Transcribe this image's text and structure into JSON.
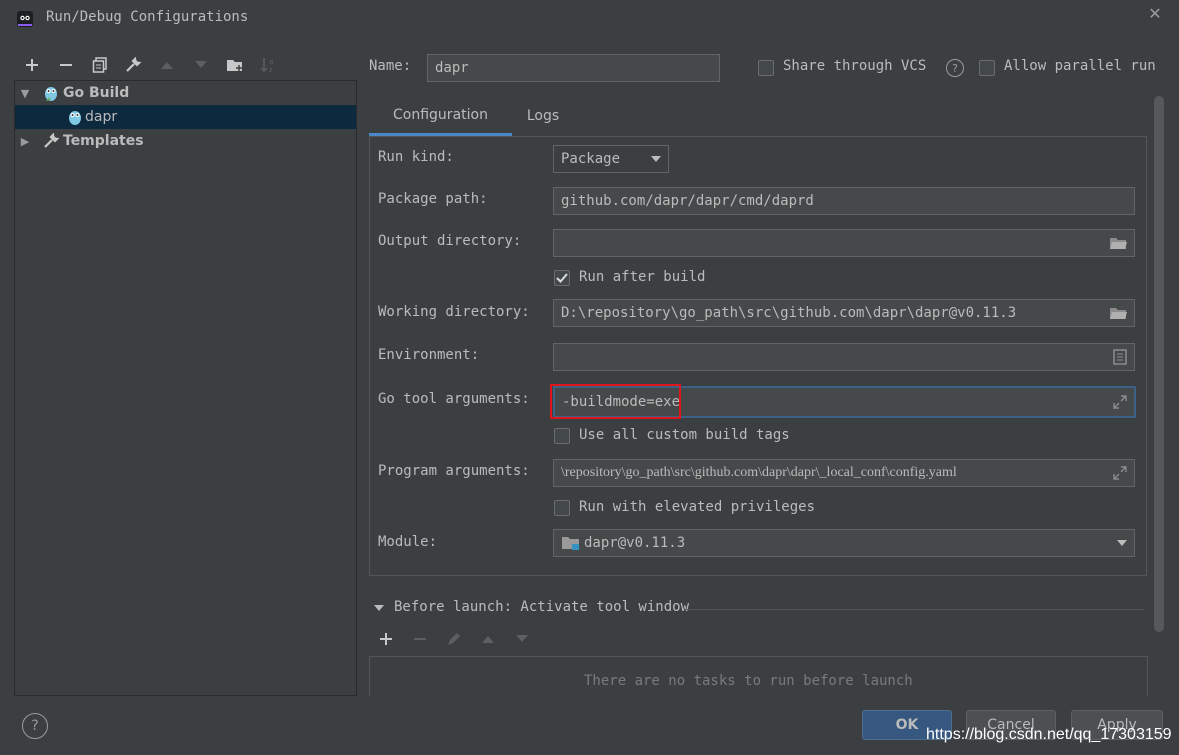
{
  "window": {
    "title": "Run/Debug Configurations"
  },
  "tree": {
    "items": [
      {
        "label": "Go Build"
      },
      {
        "label": "dapr"
      },
      {
        "label": "Templates"
      }
    ]
  },
  "header": {
    "name_label": "Name:",
    "name_value": "dapr",
    "share_label": "Share through VCS",
    "parallel_label": "Allow parallel run"
  },
  "tabs": [
    {
      "label": "Configuration"
    },
    {
      "label": "Logs"
    }
  ],
  "form": {
    "run_kind_label": "Run kind:",
    "run_kind_value": "Package",
    "package_path_label": "Package path:",
    "package_path_value": "github.com/dapr/dapr/cmd/daprd",
    "output_dir_label": "Output directory:",
    "output_dir_value": "",
    "run_after_build_label": "Run after build",
    "working_dir_label": "Working directory:",
    "working_dir_value": "D:\\repository\\go_path\\src\\github.com\\dapr\\dapr@v0.11.3",
    "environment_label": "Environment:",
    "environment_value": "",
    "go_tool_args_label": "Go tool arguments:",
    "go_tool_args_value": "-buildmode=exe",
    "custom_tags_label": "Use all custom build tags",
    "program_args_label": "Program arguments:",
    "program_args_value": "\\repository\\go_path\\src\\github.com\\dapr\\dapr\\_local_conf\\config.yaml",
    "elevated_label": "Run with elevated privileges",
    "module_label": "Module:",
    "module_value": "dapr@v0.11.3"
  },
  "before_launch": {
    "title": "Before launch: Activate tool window",
    "empty_text": "There are no tasks to run before launch"
  },
  "buttons": {
    "ok": "OK",
    "cancel": "Cancel",
    "apply": "Apply",
    "help": "?"
  },
  "watermark": "https://blog.csdn.net/qq_17303159",
  "colors": {
    "background": "#3c3f41",
    "selection": "#0d293e",
    "primary_button": "#365880",
    "highlight_box": "#e0141b",
    "focus_border": "#3d6185"
  }
}
